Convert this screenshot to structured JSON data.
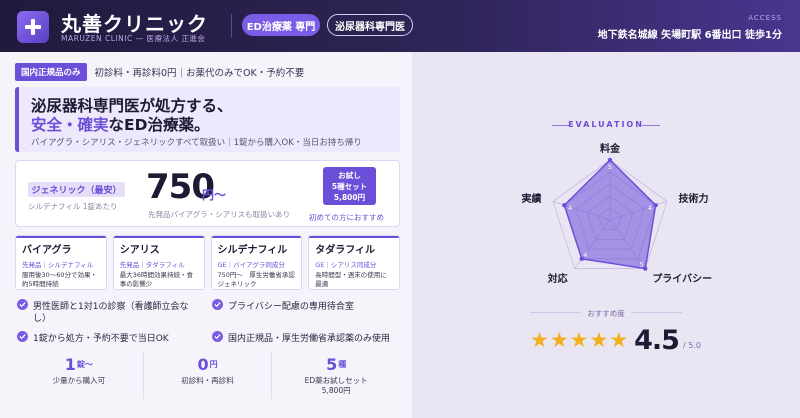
{
  "header": {
    "brand_name": "丸善クリニック",
    "brand_sub": "MARUZEN CLINIC — 医療法人 正進会",
    "tag_ed": "ED治療薬 専門",
    "tag_uro": "泌尿器科専門医",
    "access_label": "ACCESS",
    "access_text": "地下鉄名城線 矢場町駅 6番出口 徒歩1分"
  },
  "badge": {
    "label": "国内正規品のみ",
    "text": "初診料・再診料0円｜お薬代のみでOK・予約不要"
  },
  "hero": {
    "line1": "泌尿器科専門医が処方する、",
    "line2_accent": "安全・確実",
    "line2_rest": "なED治療薬。",
    "desc": "バイアグラ・シアリス・ジェネリックすべて取扱い｜1錠から購入OK・当日お持ち帰り"
  },
  "price": {
    "generic_label": "ジェネリック（最安）",
    "generic_sub": "シルデナフィル 1錠あたり",
    "amount": "750",
    "unit": "円〜",
    "note": "先発品バイアグラ・シアリスも取扱いあり",
    "trial_lines": [
      "お試し",
      "5種セット",
      "5,800円"
    ],
    "trial_note": "初めての方におすすめ"
  },
  "medicines": [
    {
      "name": "バイアグラ",
      "type": "先発品｜シルデナフィル",
      "desc": "服用後30〜60分で効果・約5時間持続"
    },
    {
      "name": "シアリス",
      "type": "先発品｜タダラフィル",
      "desc": "最大36時間効果持続・食事の影響少"
    },
    {
      "name": "シルデナフィル",
      "type": "GE｜バイアグラ同成分",
      "desc": "750円〜　厚生労働省承認ジェネリック"
    },
    {
      "name": "タダラフィル",
      "type": "GE｜シアリス同成分",
      "desc": "長時間型・週末の使用に最適"
    }
  ],
  "features": {
    "f1_a": "男性医師と1対1の診察（看護師立会な",
    "f1_b": "し）",
    "f2": "プライバシー配慮の専用待合室",
    "f3": "1錠から処方・予約不要で当日OK",
    "f4": "国内正規品・厚生労働省承認薬のみ使用"
  },
  "stats": [
    {
      "value": "1",
      "unit": "錠〜",
      "label": "少量から購入可"
    },
    {
      "value": "0",
      "unit": "円",
      "label": "初診料・再診料"
    },
    {
      "value": "5",
      "unit": "種",
      "label": "ED薬お試しセット\n5,800円"
    }
  ],
  "evaluation": {
    "title": "EVALUATION",
    "axes": [
      {
        "label": "料金",
        "value": 5,
        "max": 5
      },
      {
        "label": "技術力",
        "value": 4,
        "max": 5
      },
      {
        "label": "プライバシー",
        "value": 5,
        "max": 5
      },
      {
        "label": "対応",
        "value": 4,
        "max": 5
      },
      {
        "label": "実績",
        "value": 4,
        "max": 5
      }
    ],
    "recommend_label": "おすすめ度",
    "stars": 5,
    "score": "4.5",
    "score_max": "/ 5.0"
  },
  "colors": {
    "accent": "#6b4fd8",
    "star": "#f2b01e",
    "header_dark": "#211a3d"
  }
}
